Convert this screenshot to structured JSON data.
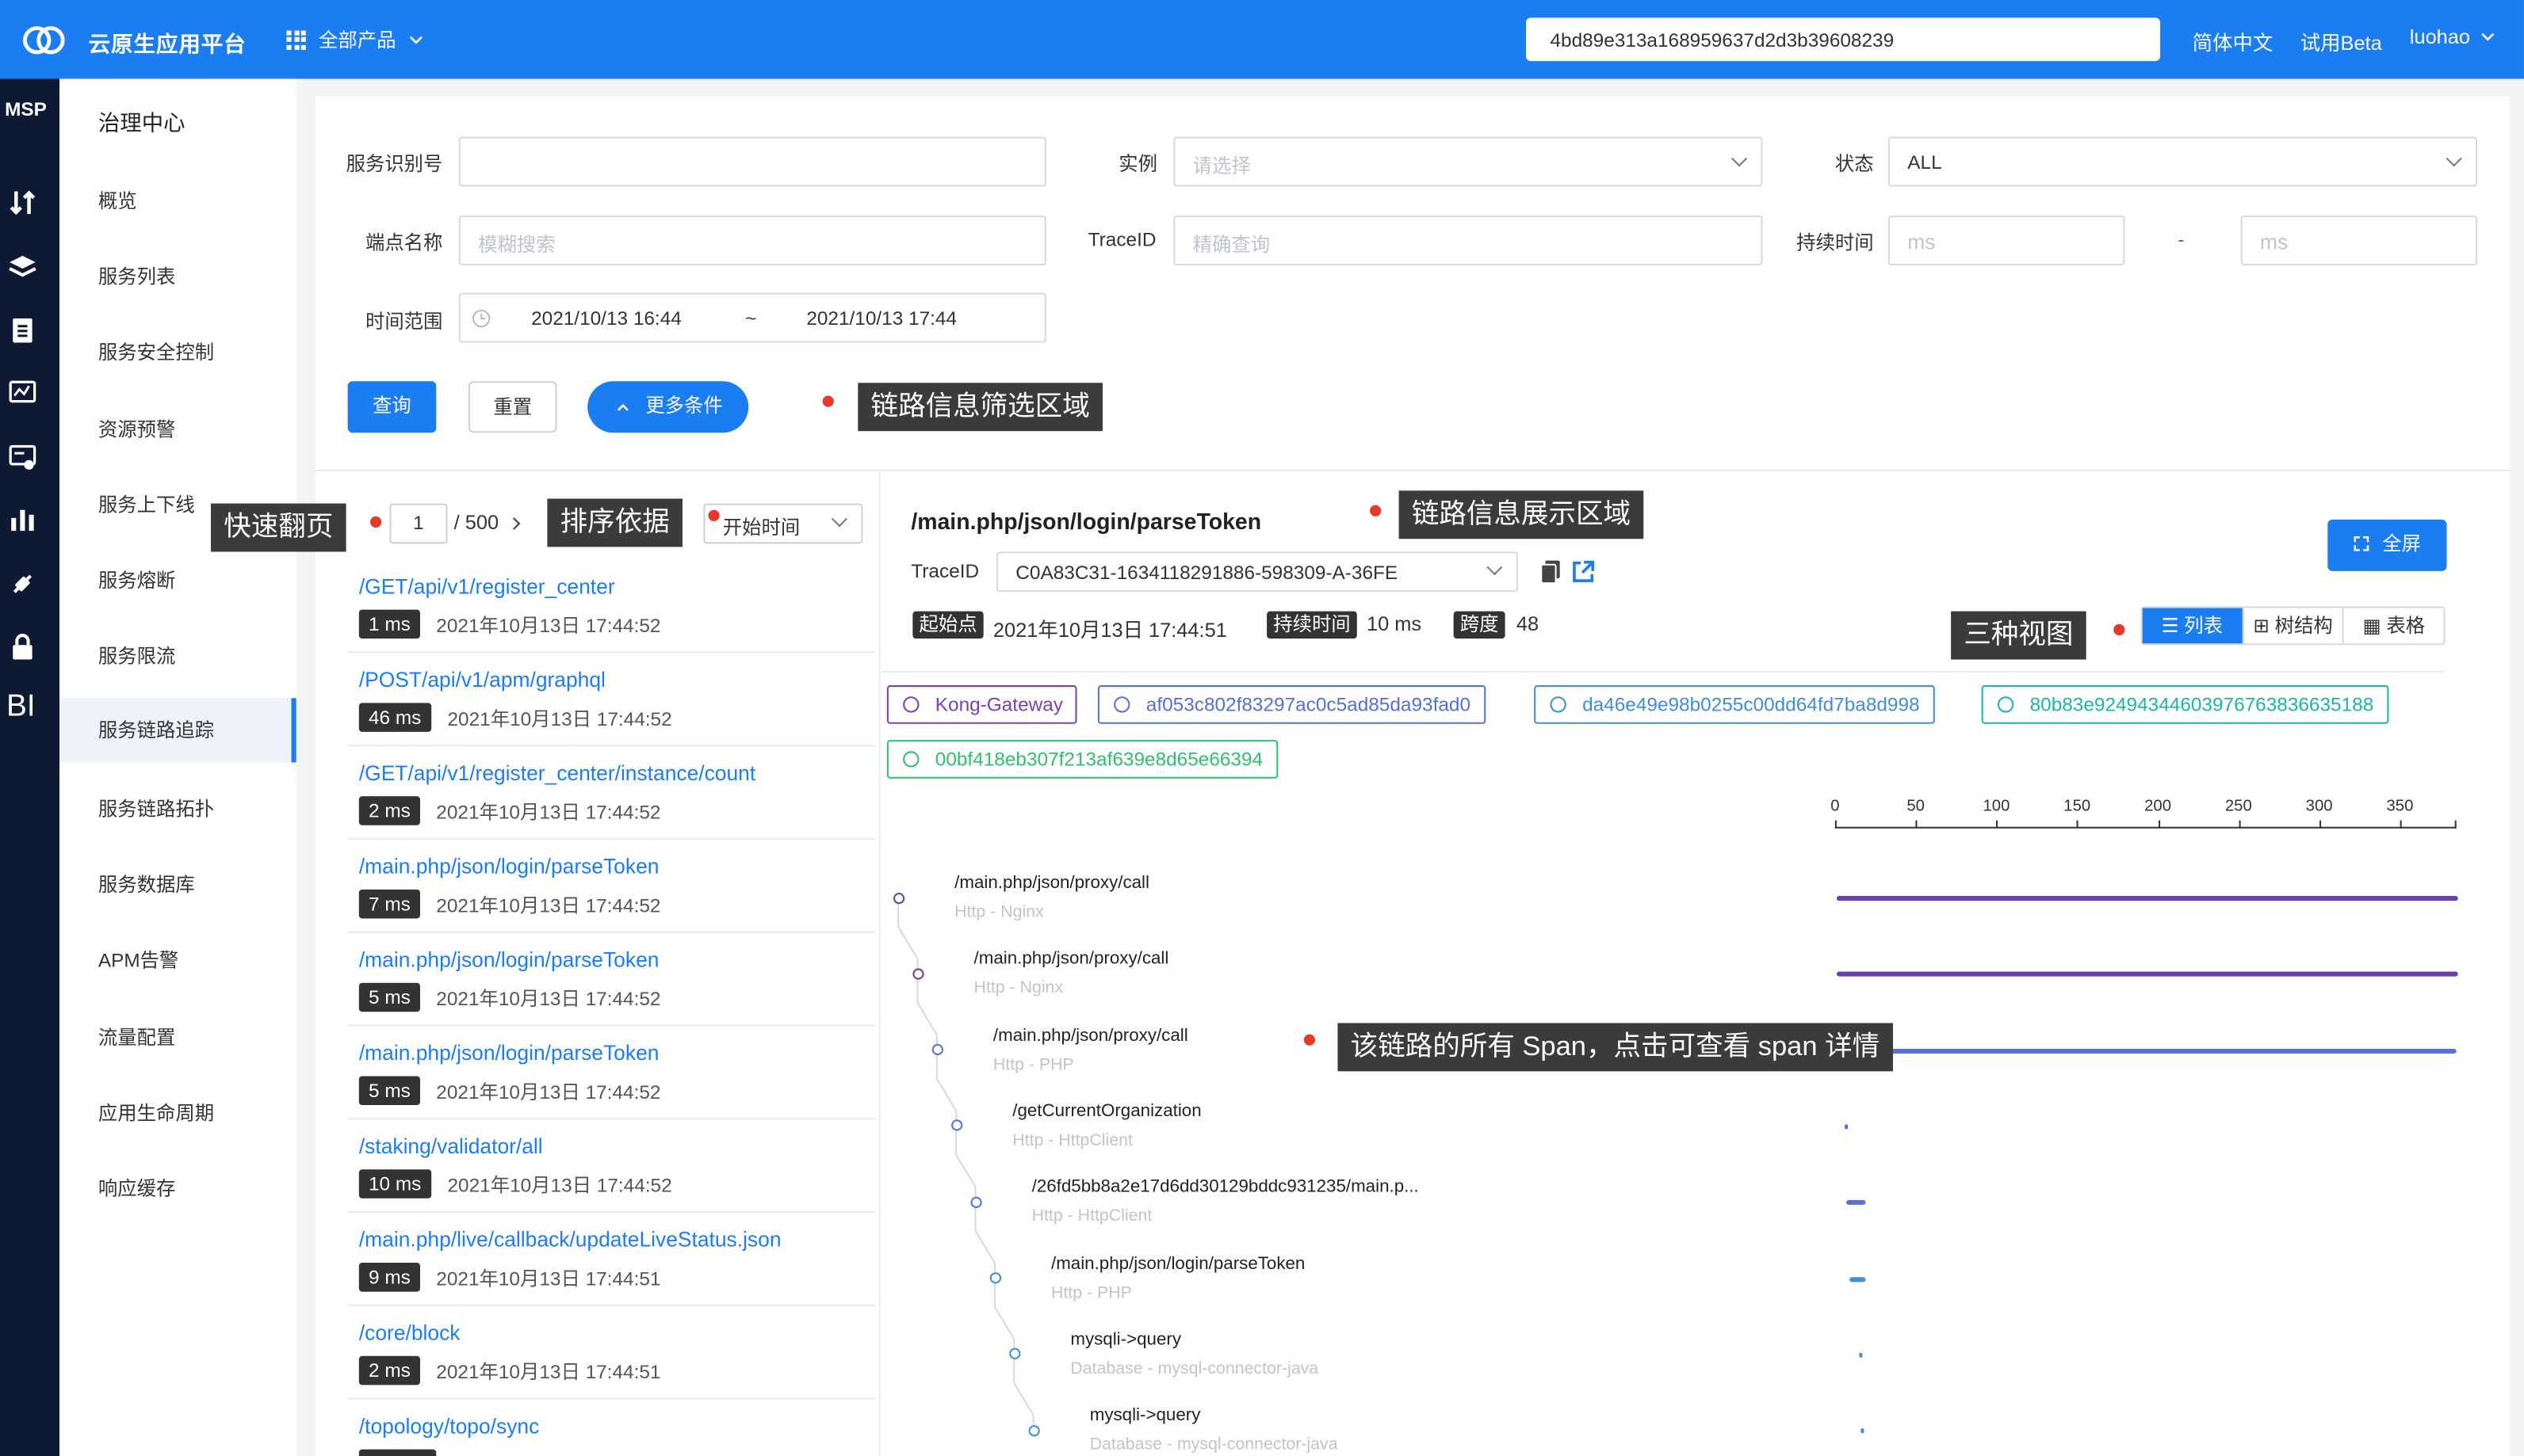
{
  "topbar": {
    "brand": "云原生应用平台",
    "all_products": "全部产品",
    "search_value": "4bd89e313a168959637d2d3b39608239",
    "lang": "简体中文",
    "beta": "试用Beta",
    "user": "luohao"
  },
  "sidebar": {
    "app": "MSP",
    "bi": "BI"
  },
  "menu": {
    "title": "治理中心",
    "items": [
      "概览",
      "服务列表",
      "服务安全控制",
      "资源预警",
      "服务上下线",
      "服务熔断",
      "服务限流",
      "服务链路追踪",
      "服务链路拓扑",
      "服务数据库",
      "APM告警",
      "流量配置",
      "应用生命周期",
      "响应缓存"
    ],
    "active": "服务链路追踪"
  },
  "filters": {
    "service_id_label": "服务识别号",
    "service_id_value": "",
    "instance_label": "实例",
    "instance_placeholder": "请选择",
    "status_label": "状态",
    "status_value": "ALL",
    "endpoint_label": "端点名称",
    "endpoint_placeholder": "模糊搜索",
    "traceid_label": "TraceID",
    "traceid_placeholder": "精确查询",
    "duration_label": "持续时间",
    "duration_min_placeholder": "ms",
    "duration_sep": "-",
    "duration_max_placeholder": "ms",
    "time_label": "时间范围",
    "time_start": "2021/10/13 16:44",
    "time_sep": "~",
    "time_end": "2021/10/13 17:44",
    "query": "查询",
    "reset": "重置",
    "more": "更多条件"
  },
  "annotations": {
    "filter_area": "链路信息筛选区域",
    "quick_page": "快速翻页",
    "sort_by": "排序依据",
    "display_area": "链路信息展示区域",
    "three_views": "三种视图",
    "spans": "该链路的所有 Span，点击可查看 span 详情"
  },
  "list": {
    "page": "1",
    "total": "/ 500",
    "sort": "开始时间",
    "traces": [
      {
        "path": "/GET/api/v1/register_center",
        "dur": "1 ms",
        "time": "2021年10月13日 17:44:52"
      },
      {
        "path": "/POST/api/v1/apm/graphql",
        "dur": "46 ms",
        "time": "2021年10月13日 17:44:52"
      },
      {
        "path": "/GET/api/v1/register_center/instance/count",
        "dur": "2 ms",
        "time": "2021年10月13日 17:44:52"
      },
      {
        "path": "/main.php/json/login/parseToken",
        "dur": "7 ms",
        "time": "2021年10月13日 17:44:52"
      },
      {
        "path": "/main.php/json/login/parseToken",
        "dur": "5 ms",
        "time": "2021年10月13日 17:44:52"
      },
      {
        "path": "/main.php/json/login/parseToken",
        "dur": "5 ms",
        "time": "2021年10月13日 17:44:52"
      },
      {
        "path": "/staking/validator/all",
        "dur": "10 ms",
        "time": "2021年10月13日 17:44:52"
      },
      {
        "path": "/main.php/live/callback/updateLiveStatus.json",
        "dur": "9 ms",
        "time": "2021年10月13日 17:44:51"
      },
      {
        "path": "/core/block",
        "dur": "2 ms",
        "time": "2021年10月13日 17:44:51"
      },
      {
        "path": "/topology/topo/sync",
        "dur": "",
        "time": ""
      }
    ]
  },
  "detail": {
    "title": "/main.php/json/login/parseToken",
    "fullscreen": "全屏",
    "traceid_label": "TraceID",
    "traceid_value": "C0A83C31-1634118291886-598309-A-36FE",
    "start_label": "起始点",
    "start_value": "2021年10月13日 17:44:51",
    "duration_label": "持续时间",
    "duration_value": "10 ms",
    "span_label": "跨度",
    "span_value": "48",
    "views": [
      "列表",
      "树结构",
      "表格"
    ],
    "services": [
      {
        "name": "Kong-Gateway",
        "color": "#7b3fb6"
      },
      {
        "name": "af053c802f83297ac0c5ad85da93fad0",
        "color": "#5470d6"
      },
      {
        "name": "da46e49e98b0255c00dd64fd7ba8d998",
        "color": "#3d8fd6"
      },
      {
        "name": "80b83e92494344603976763836635188",
        "color": "#1ab7a8"
      },
      {
        "name": "00bf418eb307f213af639e8d65e66394",
        "color": "#2dc26b"
      }
    ],
    "ruler_ticks": [
      "0",
      "50",
      "100",
      "150",
      "200",
      "250",
      "300",
      "350"
    ],
    "ruler_max": 385,
    "spans": [
      {
        "name": "/main.php/json/proxy/call",
        "type": "Http - Nginx",
        "start": 0,
        "dur": 385,
        "color": "#6a3fb0"
      },
      {
        "name": "/main.php/json/proxy/call",
        "type": "Http - Nginx",
        "start": 0,
        "dur": 385,
        "color": "#6a3fb0"
      },
      {
        "name": "/main.php/json/proxy/call",
        "type": "Http - PHP",
        "start": 0,
        "dur": 384,
        "color": "#5870d8"
      },
      {
        "name": "/getCurrentOrganization",
        "type": "Http - HttpClient",
        "start": 5,
        "dur": 1,
        "color": "#5870d8"
      },
      {
        "name": "/26fd5bb8a2e17d6dd30129bddc931235/main.p...",
        "type": "Http - HttpClient",
        "start": 6,
        "dur": 12,
        "color": "#5870d8"
      },
      {
        "name": "/main.php/json/login/parseToken",
        "type": "Http - PHP",
        "start": 8,
        "dur": 10,
        "color": "#3d8fd6"
      },
      {
        "name": "mysqli->query",
        "type": "Database - mysql-connector-java",
        "start": 14,
        "dur": 1,
        "color": "#3d8fd6"
      },
      {
        "name": "mysqli->query",
        "type": "Database - mysql-connector-java",
        "start": 15,
        "dur": 1,
        "color": "#3d8fd6"
      }
    ]
  }
}
